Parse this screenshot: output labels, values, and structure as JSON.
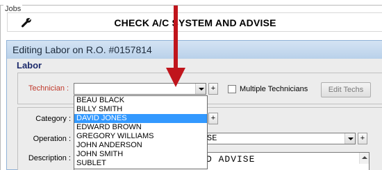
{
  "jobs": {
    "legend": "Jobs",
    "job_title": "CHECK A/C SYSTEM AND ADVISE"
  },
  "dialog": {
    "title": "Editing Labor on R.O. #0157814",
    "section_heading": "Labor"
  },
  "technician": {
    "label": "Technician :",
    "value": "",
    "plus_label": "+",
    "multiple_label": "Multiple Technicians",
    "multiple_checked": false,
    "edit_button": "Edit Techs"
  },
  "fields": {
    "category_label": "Category :",
    "category_plus": "+",
    "operation_label": "Operation :",
    "operation_value_fragment": "SE",
    "operation_plus": "+",
    "description_label": "Description :",
    "description_value_fragment": "D ADVISE"
  },
  "dropdown": {
    "items": [
      "BEAU BLACK",
      "BILLY SMITH",
      "DAVID JONES",
      "EDWARD BROWN",
      "GREGORY WILLIAMS",
      "JOHN ANDERSON",
      "JOHN SMITH",
      "SUBLET"
    ],
    "selected": "DAVID JONES"
  },
  "colors": {
    "arrow": "#c0151c",
    "selection": "#3399ff",
    "technician_label": "#c0392b",
    "labor_heading": "#1c2a6b"
  },
  "icons": {
    "job_icon": "wrench-icon"
  }
}
